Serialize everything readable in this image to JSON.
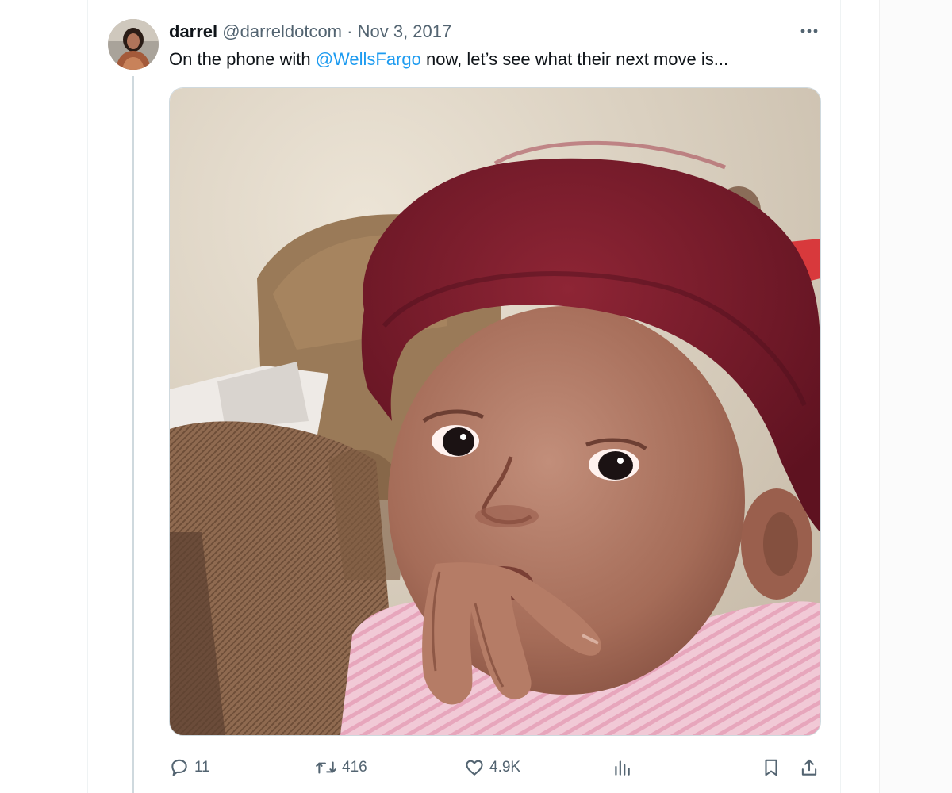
{
  "tweet": {
    "author": {
      "name": "darrel",
      "handle": "@darreldotcom"
    },
    "separator": "·",
    "date": "Nov 3, 2017",
    "text_before_mention": "On the phone with ",
    "mention": "@WellsFargo",
    "text_after_mention": " now, let’s see what their next move is..."
  },
  "actions": {
    "replies": "11",
    "retweets": "416",
    "likes": "4.9K"
  },
  "icons": {
    "reply": "reply-icon",
    "retweet": "retweet-icon",
    "like": "heart-icon",
    "views": "analytics-icon",
    "bookmark": "bookmark-icon",
    "share": "share-icon",
    "more": "more-icon"
  },
  "colors": {
    "link": "#1d9bf0",
    "secondary_text": "#536471",
    "hat": "#7d1b2c"
  }
}
